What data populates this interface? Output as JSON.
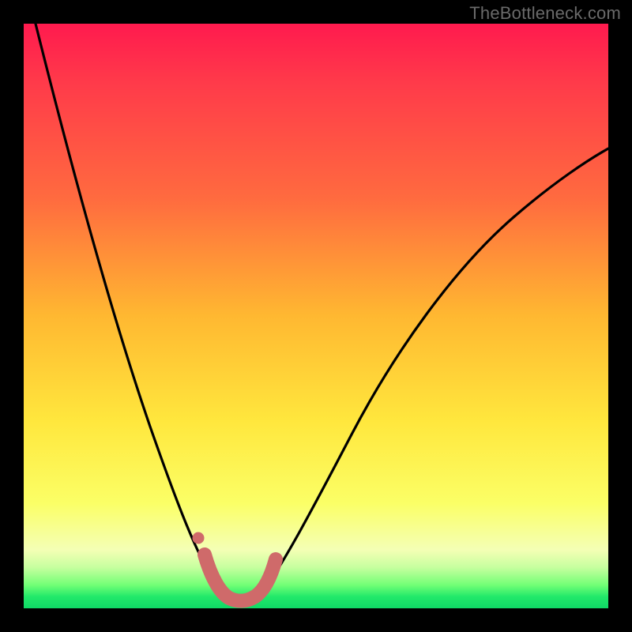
{
  "watermark": {
    "text": "TheBottleneck.com"
  },
  "chart_data": {
    "type": "line",
    "title": "",
    "xlabel": "",
    "ylabel": "",
    "xlim": [
      0,
      100
    ],
    "ylim": [
      0,
      100
    ],
    "grid": false,
    "series": [
      {
        "name": "bottleneck-curve",
        "x": [
          2,
          5,
          8,
          11,
          14,
          17,
          20,
          23,
          25,
          27,
          29,
          30.5,
          32,
          33.5,
          35,
          36.5,
          38,
          40,
          43,
          46,
          50,
          55,
          60,
          66,
          73,
          82,
          92,
          100
        ],
        "values": [
          100,
          90,
          80,
          70,
          60,
          50,
          40,
          31,
          24,
          18,
          12,
          8,
          5,
          3,
          1.5,
          1,
          1.5,
          3,
          7,
          12,
          20,
          29,
          37,
          45,
          53,
          61,
          69,
          75
        ]
      },
      {
        "name": "minimum-marker",
        "x": [
          30,
          30.5,
          31.5,
          33,
          35,
          37,
          38.5,
          39.5,
          40
        ],
        "values": [
          10,
          6,
          3,
          1.5,
          1,
          1.5,
          3,
          6,
          10
        ]
      }
    ],
    "annotations": []
  },
  "colors": {
    "curve": "#000000",
    "marker": "#cf6a6a",
    "marker_dot": "#cf6a6a",
    "background_top": "#ff1a4e",
    "background_bottom": "#0fd966"
  }
}
